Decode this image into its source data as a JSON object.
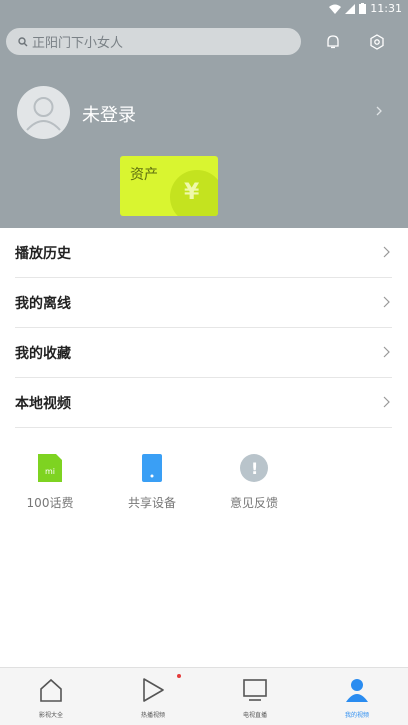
{
  "status_bar": {
    "time": "11:31"
  },
  "search": {
    "placeholder": "正阳门下小女人"
  },
  "profile": {
    "login_text": "未登录",
    "asset_label": "资产",
    "asset_symbol": "¥"
  },
  "menu": {
    "items": [
      {
        "label": "播放历史"
      },
      {
        "label": "我的离线"
      },
      {
        "label": "我的收藏"
      },
      {
        "label": "本地视频"
      }
    ]
  },
  "tiles": [
    {
      "label": "100话费",
      "icon": "sim-card-icon",
      "color": "#7ed321",
      "icon_text": "mi"
    },
    {
      "label": "共享设备",
      "icon": "phone-device-icon",
      "color": "#3a9ff5"
    },
    {
      "label": "意见反馈",
      "icon": "feedback-icon",
      "color": "#b9c4cb",
      "icon_text": "!"
    }
  ],
  "bottom_nav": [
    {
      "label": "影视大全",
      "icon": "home-icon",
      "active": false
    },
    {
      "label": "热播视频",
      "icon": "play-icon",
      "active": false
    },
    {
      "label": "电视直播",
      "icon": "tv-icon",
      "active": false
    },
    {
      "label": "我的视频",
      "icon": "user-icon",
      "active": true
    }
  ],
  "colors": {
    "header_bg": "#9aa3a8",
    "accent": "#2a8cf0",
    "asset_card": "#d9f530"
  }
}
